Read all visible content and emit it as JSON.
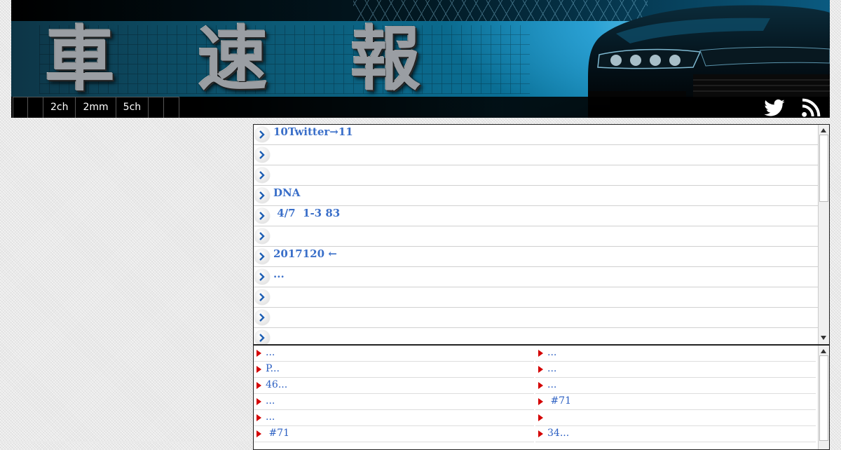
{
  "header": {
    "logo_text": "車速報",
    "nav_tabs": [
      "",
      "",
      "2ch",
      "2mm",
      "5ch",
      "",
      ""
    ],
    "social": [
      "twitter-icon",
      "rss-icon"
    ],
    "colors": {
      "banner_blue": "#0a6f95",
      "banner_dark": "#000000"
    }
  },
  "news": {
    "items": [
      "10Twitter→11",
      "",
      "",
      "DNA",
      " 4/7  1-3 83",
      "",
      "2017120 ←",
      "...",
      "",
      "",
      ""
    ],
    "link_color": "#3a6fc9"
  },
  "links": {
    "rows": [
      [
        "...",
        "..."
      ],
      [
        "P...",
        "..."
      ],
      [
        "46...",
        "..."
      ],
      [
        "...",
        " #71"
      ],
      [
        "...",
        ""
      ],
      [
        " #71",
        "34..."
      ]
    ],
    "link_color": "#2b5fc2",
    "marker_color": "#d40000"
  }
}
